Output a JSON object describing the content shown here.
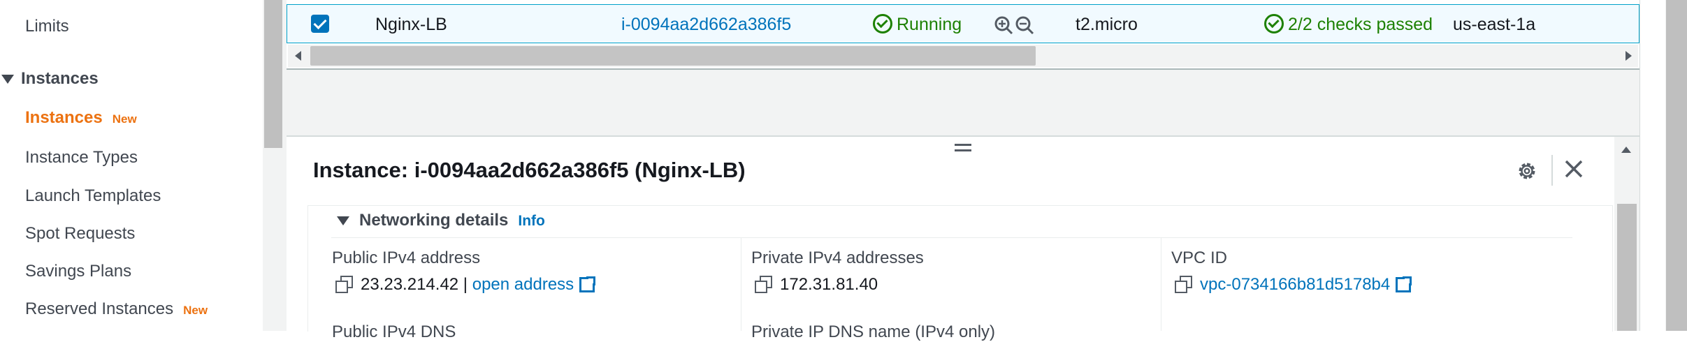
{
  "sidebar": {
    "limits": "Limits",
    "section_instances": "Instances",
    "items": [
      {
        "label": "Instances",
        "badge": "New"
      },
      {
        "label": "Instance Types"
      },
      {
        "label": "Launch Templates"
      },
      {
        "label": "Spot Requests"
      },
      {
        "label": "Savings Plans"
      },
      {
        "label": "Reserved Instances",
        "badge": "New"
      }
    ]
  },
  "table": {
    "row": {
      "name": "Nginx-LB",
      "instance_id": "i-0094aa2d662a386f5",
      "state": "Running",
      "type": "t2.micro",
      "status_check": "2/2 checks passed",
      "az": "us-east-1a",
      "selected": true
    }
  },
  "details": {
    "title": "Instance: i-0094aa2d662a386f5 (Nginx-LB)",
    "section": {
      "title": "Networking details",
      "info": "Info",
      "fields": [
        {
          "label": "Public IPv4 address",
          "value": "23.23.214.42",
          "separator": " | ",
          "link": "open address"
        },
        {
          "label": "Private IPv4 addresses",
          "value": "172.31.81.40"
        },
        {
          "label": "VPC ID",
          "link": "vpc-0734166b81d5178b4"
        }
      ],
      "next_labels": [
        "Public IPv4 DNS",
        "Private IP DNS name (IPv4 only)"
      ]
    }
  },
  "colors": {
    "accent": "#ec7211",
    "link": "#0073bb",
    "success": "#1d8102"
  }
}
